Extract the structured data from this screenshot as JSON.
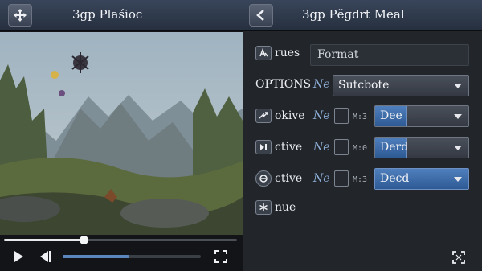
{
  "player": {
    "title": "3gp Plaśioc",
    "progress": 0.34,
    "volume": 0.48
  },
  "panel": {
    "title": "3gp Pĕgdrt Meal",
    "format_label": "rues",
    "format_value": "Format",
    "options_label": "OPTIONS",
    "options_ne": "Ne",
    "options_value": "Sutcbote",
    "rows": [
      {
        "label": "okive",
        "ne": "Ne",
        "tiny": "M:3",
        "value": "Dee"
      },
      {
        "label": "ctive",
        "ne": "Ne",
        "tiny": "M:0",
        "value": "Derd"
      },
      {
        "label": "ctive",
        "ne": "Ne",
        "tiny": "M:3",
        "value": "Decd"
      }
    ],
    "last_label": "nue"
  },
  "colors": {
    "accent": "#4f7fbd",
    "titlebar": "#2f3a4b"
  }
}
